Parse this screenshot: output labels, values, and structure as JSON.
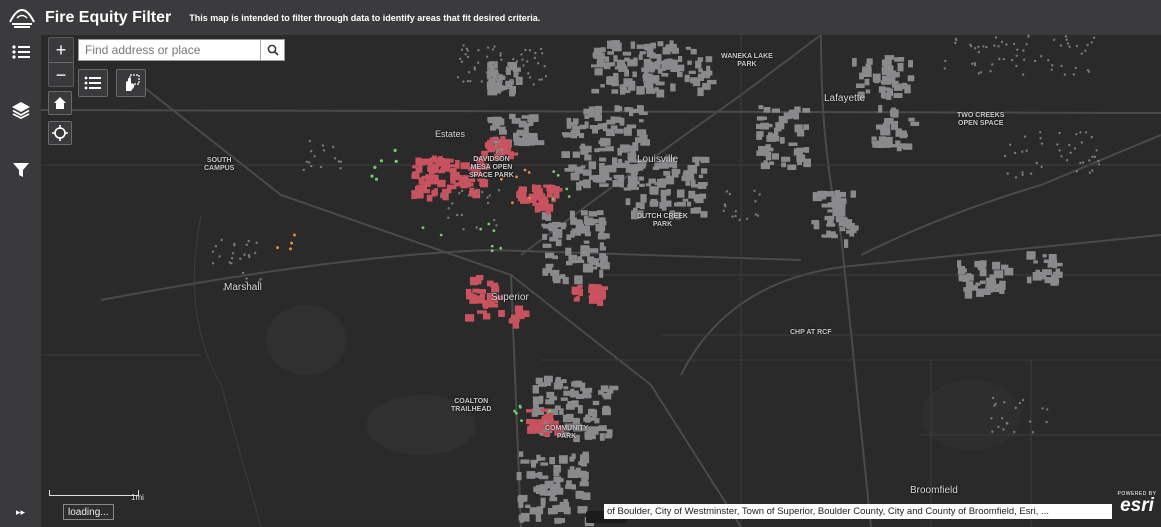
{
  "header": {
    "title": "Fire Equity Filter",
    "subtitle": "This map is intended to filter through data to identify areas that fit desired criteria."
  },
  "rail": {
    "icons": [
      "list-icon",
      "layers-icon",
      "filter-icon"
    ],
    "expand_glyph": "▸▸"
  },
  "map": {
    "search": {
      "placeholder": "Find address or place",
      "value": ""
    },
    "zoom": {
      "in": "+",
      "out": "−"
    },
    "labels": {
      "waneka": "WANEKA LAKE\nPARK",
      "lafayette": "Lafayette",
      "two_creeks": "TWO CREEKS\nOPEN SPACE",
      "south_campus": "SOUTH\nCAMPUS",
      "estates": "Estates",
      "davidson": "DAVIDSON\nMESA OPEN\nSPACE PARK",
      "louisville": "Louisville",
      "dutch_creek": "DUTCH CREEK\nPARK",
      "marshall": "Marshall",
      "superior": "Superior",
      "chp": "CHP AT RCF",
      "coalton": "COALTON\nTRAILHEAD",
      "community": "COMMUNITY\nPARK",
      "broomfield": "Broomfield"
    },
    "scale_label": "1mi",
    "loading": "loading...",
    "attribution": "of Boulder, City of Westminster, Town of Superior, Boulder County, City and County of Broomfield, Esri, ...",
    "esri": {
      "powered_by": "POWERED BY",
      "name": "esri"
    }
  },
  "colors": {
    "header": "#3b3b3d",
    "map_bg": "#2a2a2b",
    "parcel_gray": "#8a8a8c",
    "parcel_red": "#c9525f",
    "dot_green": "#6fcf6a",
    "dot_orange": "#e08a3a"
  }
}
